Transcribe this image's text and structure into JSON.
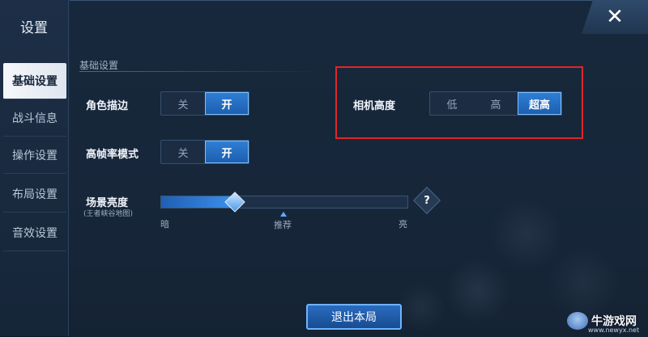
{
  "sidebar": {
    "title": "设置",
    "items": [
      {
        "label": "基础设置",
        "active": true
      },
      {
        "label": "战斗信息",
        "active": false
      },
      {
        "label": "操作设置",
        "active": false
      },
      {
        "label": "布局设置",
        "active": false
      },
      {
        "label": "音效设置",
        "active": false
      }
    ]
  },
  "section": {
    "title": "基础设置"
  },
  "settings": {
    "outline": {
      "label": "角色描边",
      "options": [
        "关",
        "开"
      ],
      "selected": "开"
    },
    "high_fps": {
      "label": "高帧率模式",
      "options": [
        "关",
        "开"
      ],
      "selected": "开"
    },
    "camera_height": {
      "label": "相机高度",
      "options": [
        "低",
        "高",
        "超高"
      ],
      "selected": "超高"
    },
    "brightness": {
      "label": "场景亮度",
      "sublabel": "(王者峡谷地图)",
      "min_label": "暗",
      "max_label": "亮",
      "recommend_label": "推荐",
      "value_fraction": 0.3
    }
  },
  "help_label": "?",
  "close_label": "✕",
  "exit_button": "退出本局",
  "watermark": {
    "name": "牛游戏网",
    "url": "www.newyx.net"
  },
  "colors": {
    "accent": "#2f7ed4",
    "highlight_box": "#e0262a"
  }
}
